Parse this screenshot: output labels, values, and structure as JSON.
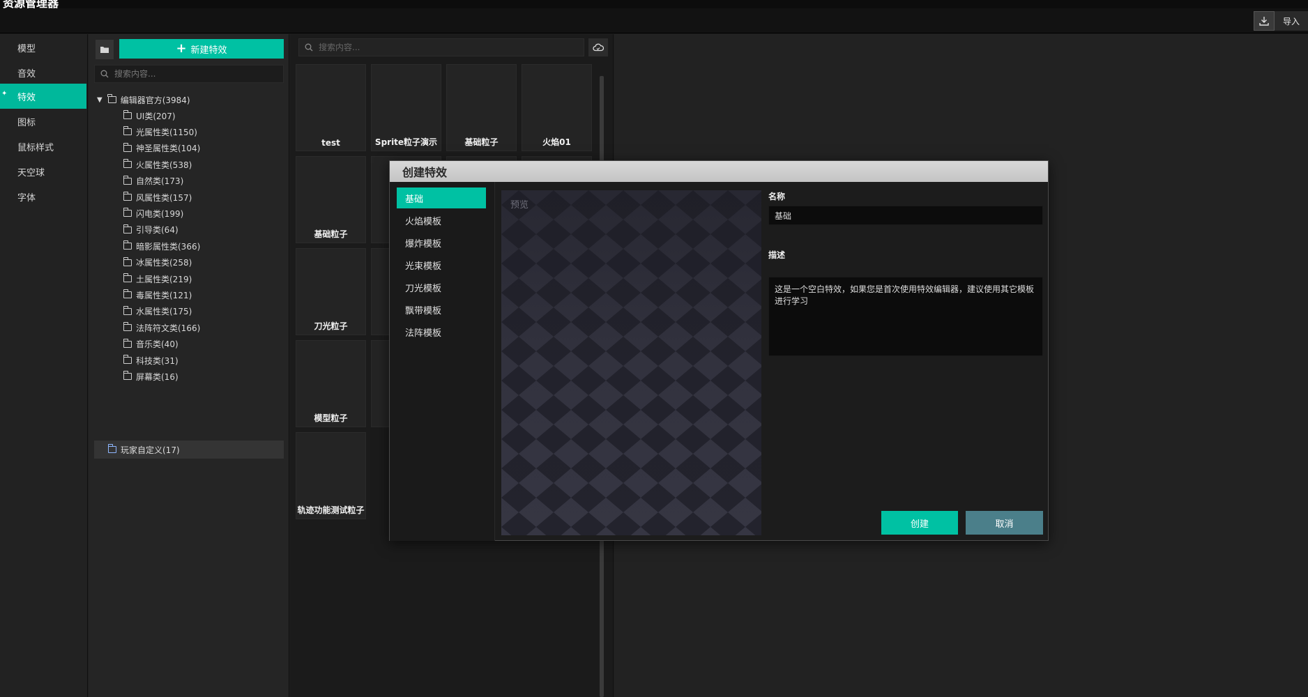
{
  "window": {
    "title": "资源管理器"
  },
  "toolbar": {
    "import_label": "导入",
    "import_icon": "download-icon"
  },
  "categories": [
    {
      "label": "模型"
    },
    {
      "label": "音效"
    },
    {
      "label": "特效"
    },
    {
      "label": "图标"
    },
    {
      "label": "鼠标样式"
    },
    {
      "label": "天空球"
    },
    {
      "label": "字体"
    }
  ],
  "tree": {
    "new_button": "新建特效",
    "search_placeholder": "搜索内容...",
    "root": "编辑器官方(3984)",
    "children": [
      "UI类(207)",
      "光属性类(1150)",
      "神圣属性类(104)",
      "火属性类(538)",
      "自然类(173)",
      "风属性类(157)",
      "闪电类(199)",
      "引导类(64)",
      "暗影属性类(366)",
      "冰属性类(258)",
      "土属性类(219)",
      "毒属性类(121)",
      "水属性类(175)",
      "法阵符文类(166)",
      "音乐类(40)",
      "科技类(31)",
      "屏幕类(16)"
    ],
    "custom": "玩家自定义(17)"
  },
  "grid": {
    "search_placeholder": "搜索内容...",
    "tiles": [
      "test",
      "Sprite粒子演示",
      "基础粒子",
      "火焰01",
      "基础粒子",
      "刀光粒子",
      "模型粒子",
      "轨迹功能测试粒子"
    ]
  },
  "modal": {
    "title": "创建特效",
    "templates": [
      "基础",
      "火焰模板",
      "爆炸模板",
      "光束模板",
      "刀光模板",
      "飘带模板",
      "法阵模板"
    ],
    "preview_label": "预览",
    "name_label": "名称",
    "name_value": "基础",
    "desc_label": "描述",
    "desc_value": "这是一个空白特效，如果您是首次使用特效编辑器，建议使用其它模板进行学习",
    "create_label": "创建",
    "cancel_label": "取消"
  },
  "colors": {
    "accent": "#00c1a3",
    "cancel": "#4b7f8a"
  }
}
